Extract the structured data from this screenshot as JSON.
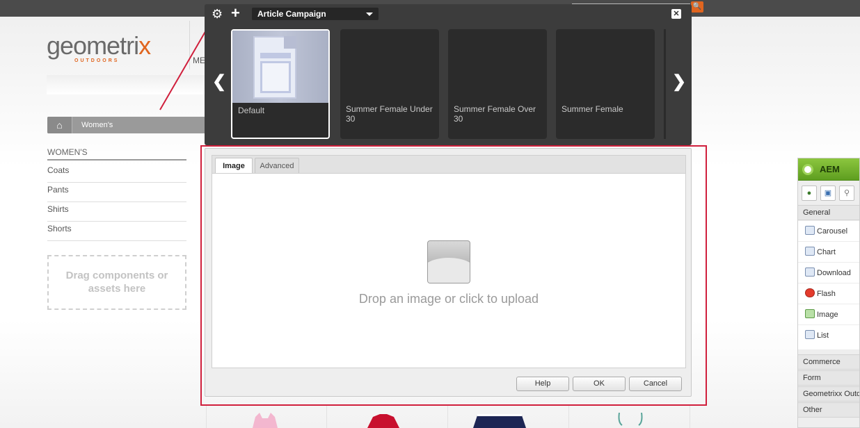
{
  "site": {
    "logo_main": "geometri",
    "logo_x": "x",
    "logo_sub": "OUTDOORS",
    "menu_truncated": "ME",
    "search_glyph": "🔍"
  },
  "breadcrumb": {
    "home_icon": "home-icon",
    "home_glyph": "⌂",
    "item": "Women's"
  },
  "left_nav": {
    "title": "WOMEN'S",
    "items": [
      {
        "label": "Coats"
      },
      {
        "label": "Pants"
      },
      {
        "label": "Shirts"
      },
      {
        "label": "Shorts"
      }
    ],
    "drop_zone_text": "Drag components or assets here"
  },
  "campaign_overlay": {
    "gear_glyph": "⚙",
    "plus_glyph": "+",
    "campaign_selected": "Article Campaign",
    "close_glyph": "✕",
    "prev_glyph": "❮",
    "next_glyph": "❯",
    "experiences": [
      {
        "label": "Default",
        "selected": true
      },
      {
        "label": "Summer Female Under 30",
        "selected": false
      },
      {
        "label": "Summer Female Over 30",
        "selected": false
      },
      {
        "label": "Summer Female",
        "selected": false
      }
    ]
  },
  "dialog": {
    "tabs": [
      {
        "label": "Image",
        "active": true
      },
      {
        "label": "Advanced",
        "active": false
      }
    ],
    "upload_text": "Drop an image or click to upload",
    "buttons": {
      "help": "Help",
      "ok": "OK",
      "cancel": "Cancel"
    }
  },
  "sidekick": {
    "title": "AEM",
    "tab_glyphs": [
      "●",
      "▣",
      "⚲"
    ],
    "group_general": "General",
    "components": [
      {
        "label": "Carousel"
      },
      {
        "label": "Chart"
      },
      {
        "label": "Download"
      },
      {
        "label": "Flash"
      },
      {
        "label": "Image"
      },
      {
        "label": "List"
      }
    ],
    "groups_bottom": [
      "Commerce",
      "Form",
      "Geometrixx Outdoors",
      "Other"
    ]
  },
  "colors": {
    "accent_orange": "#e0651f",
    "annotation_red": "#d01f3c",
    "sidekick_green": "#8cc63f",
    "overlay_dark": "#3c3c3c"
  }
}
